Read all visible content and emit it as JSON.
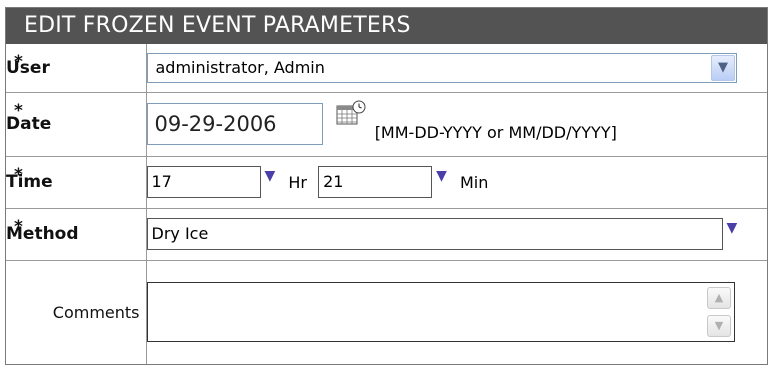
{
  "header": {
    "title": "EDIT FROZEN EVENT PARAMETERS"
  },
  "required_marker": "*",
  "user": {
    "label": "User",
    "value": "administrator, Admin",
    "arrow_icon": "chevron-down-icon"
  },
  "date": {
    "label": "Date",
    "value": "09-29-2006",
    "hint": "[MM-DD-YYYY or MM/DD/YYYY]",
    "icon": "calendar-icon"
  },
  "time": {
    "label": "Time",
    "hour_value": "17",
    "hour_unit": "Hr",
    "minute_value": "21",
    "minute_unit": "Min"
  },
  "method": {
    "label": "Method",
    "value": "Dry Ice"
  },
  "comments": {
    "label": "Comments",
    "value": ""
  },
  "colors": {
    "header_bg": "#535353",
    "arrow_purple": "#4a3fa8",
    "input_border": "#7f9db9"
  }
}
